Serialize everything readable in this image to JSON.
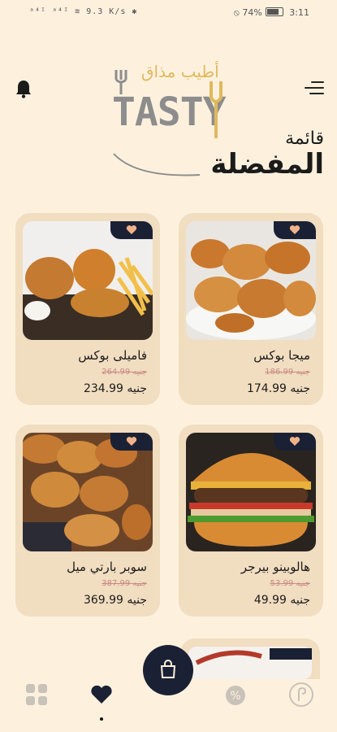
{
  "status": {
    "left_text": "ᵃ⁴ᴵ ᵃ⁴ᴵ ≋ 9.3 K/s ✱",
    "battery": "74%",
    "time": "3:11"
  },
  "logo": {
    "arabic": "أطيب مذاق",
    "latin": "TASTY"
  },
  "page_title": {
    "line1": "قائمة",
    "line2": "المفضلة"
  },
  "products": [
    {
      "name": "ميجا بوكس",
      "old_price": "186.99 جنيه",
      "price": "174.99 جنيه",
      "image": "fried-chicken"
    },
    {
      "name": "فاميلى بوكس",
      "old_price": "264.99 جنيه",
      "price": "234.99 جنيه",
      "image": "family-box"
    },
    {
      "name": "هالوبينو بيرجر",
      "old_price": "53.99 جنيه",
      "price": "49.99 جنيه",
      "image": "burger"
    },
    {
      "name": "سوبر  بارتي ميل",
      "old_price": "387.99 جنيه",
      "price": "369.99 جنيه",
      "image": "party-meal"
    }
  ],
  "colors": {
    "background": "#fdf1de",
    "card": "#f1ddc0",
    "navy": "#1b2134",
    "gold": "#e0b95c"
  },
  "nav": {
    "items": [
      "grid-icon",
      "heart-icon",
      "cart-icon",
      "percent-icon",
      "currency-icon"
    ],
    "active": "heart-icon"
  }
}
